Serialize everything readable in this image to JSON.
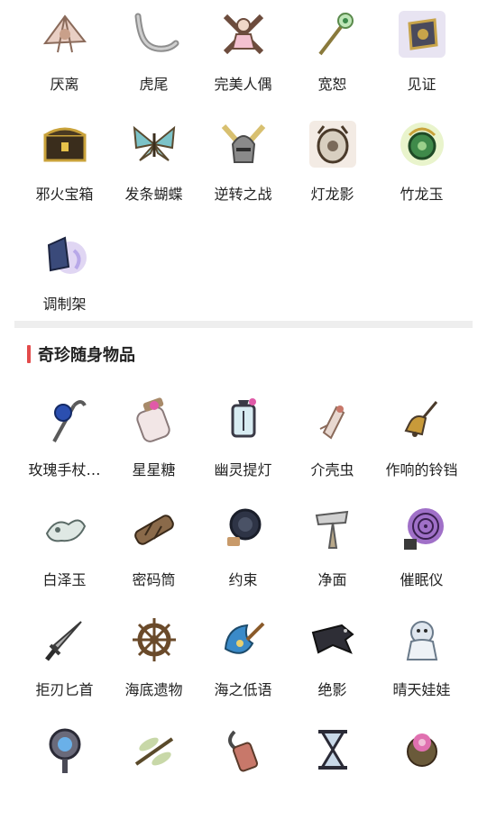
{
  "collection_top": {
    "items": [
      {
        "label": "厌离",
        "icon": "fan-icon"
      },
      {
        "label": "虎尾",
        "icon": "tail-icon"
      },
      {
        "label": "完美人偶",
        "icon": "doll-icon"
      },
      {
        "label": "宽恕",
        "icon": "staff-icon"
      },
      {
        "label": "见证",
        "icon": "badge-icon"
      },
      {
        "label": "邪火宝箱",
        "icon": "chest-icon"
      },
      {
        "label": "发条蝴蝶",
        "icon": "butterfly-icon"
      },
      {
        "label": "逆转之战",
        "icon": "helmet-icon"
      },
      {
        "label": "灯龙影",
        "icon": "lantern-dragon-icon"
      },
      {
        "label": "竹龙玉",
        "icon": "jade-dragon-icon"
      },
      {
        "label": "调制架",
        "icon": "rack-icon"
      }
    ]
  },
  "section": {
    "title": "奇珍随身物品",
    "accent": "#e34b4b"
  },
  "collection_bottom": {
    "items": [
      {
        "label": "玫瑰手杖…",
        "icon": "rose-cane-icon"
      },
      {
        "label": "星星糖",
        "icon": "candy-jar-icon"
      },
      {
        "label": "幽灵提灯",
        "icon": "ghost-lantern-icon"
      },
      {
        "label": "介壳虫",
        "icon": "shell-bug-icon"
      },
      {
        "label": "作响的铃铛",
        "icon": "bell-icon"
      },
      {
        "label": "白泽玉",
        "icon": "white-jade-icon"
      },
      {
        "label": "密码筒",
        "icon": "cryptex-icon"
      },
      {
        "label": "约束",
        "icon": "restraint-icon"
      },
      {
        "label": "净面",
        "icon": "razor-icon"
      },
      {
        "label": "催眠仪",
        "icon": "hypnosis-icon"
      },
      {
        "label": "拒刃匕首",
        "icon": "dagger-icon"
      },
      {
        "label": "海底遗物",
        "icon": "ship-wheel-icon"
      },
      {
        "label": "海之低语",
        "icon": "sea-whisper-icon"
      },
      {
        "label": "绝影",
        "icon": "crow-icon"
      },
      {
        "label": "晴天娃娃",
        "icon": "sunny-doll-icon"
      },
      {
        "label": "",
        "icon": "mirror-icon"
      },
      {
        "label": "",
        "icon": "dragonfly-icon"
      },
      {
        "label": "",
        "icon": "hook-icon"
      },
      {
        "label": "",
        "icon": "hourglass-icon"
      },
      {
        "label": "",
        "icon": "flower-orb-icon"
      }
    ]
  }
}
